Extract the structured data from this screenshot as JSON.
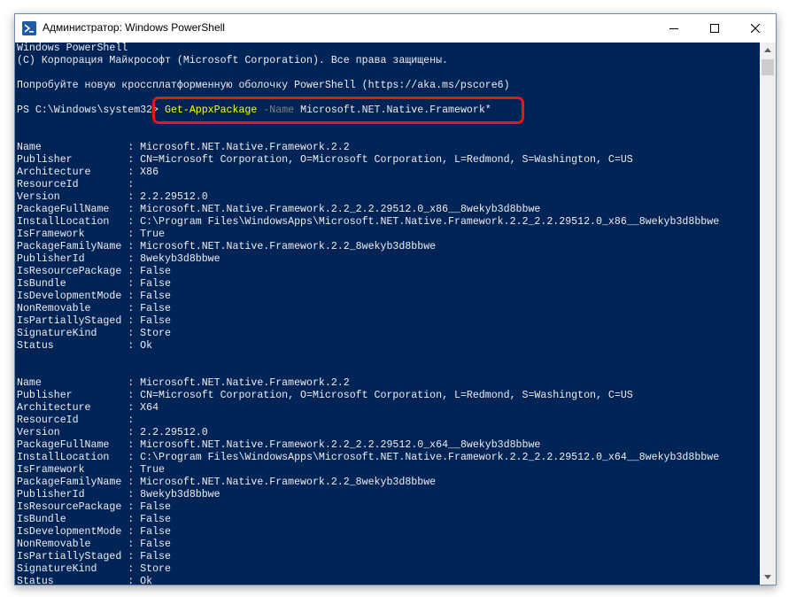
{
  "window": {
    "title": "Администратор: Windows PowerShell",
    "icon": "powershell-icon",
    "controls": [
      "minimize-icon",
      "maximize-icon",
      "close-icon"
    ]
  },
  "console": {
    "background": "#012456",
    "foreground": "#eeedf0",
    "header": [
      "Windows PowerShell",
      "(C) Корпорация Майкрософт (Microsoft Corporation). Все права защищены.",
      "",
      "Попробуйте новую кроссплатформенную оболочку PowerShell (https://aka.ms/pscore6)",
      ""
    ],
    "prompt": {
      "path": "PS C:\\Windows\\system32> ",
      "cmdlet": "Get-AppxPackage",
      "param": " -Name",
      "value": " Microsoft.NET.Native.Framework*"
    },
    "highlight_color": "#e8141e",
    "packages": [
      {
        "Name": "Microsoft.NET.Native.Framework.2.2",
        "Publisher": "CN=Microsoft Corporation, O=Microsoft Corporation, L=Redmond, S=Washington, C=US",
        "Architecture": "X86",
        "ResourceId": "",
        "Version": "2.2.29512.0",
        "PackageFullName": "Microsoft.NET.Native.Framework.2.2_2.2.29512.0_x86__8wekyb3d8bbwe",
        "InstallLocation": "C:\\Program Files\\WindowsApps\\Microsoft.NET.Native.Framework.2.2_2.2.29512.0_x86__8wekyb3d8bbwe",
        "IsFramework": "True",
        "PackageFamilyName": "Microsoft.NET.Native.Framework.2.2_8wekyb3d8bbwe",
        "PublisherId": "8wekyb3d8bbwe",
        "IsResourcePackage": "False",
        "IsBundle": "False",
        "IsDevelopmentMode": "False",
        "NonRemovable": "False",
        "IsPartiallyStaged": "False",
        "SignatureKind": "Store",
        "Status": "Ok"
      },
      {
        "Name": "Microsoft.NET.Native.Framework.2.2",
        "Publisher": "CN=Microsoft Corporation, O=Microsoft Corporation, L=Redmond, S=Washington, C=US",
        "Architecture": "X64",
        "ResourceId": "",
        "Version": "2.2.29512.0",
        "PackageFullName": "Microsoft.NET.Native.Framework.2.2_2.2.29512.0_x64__8wekyb3d8bbwe",
        "InstallLocation": "C:\\Program Files\\WindowsApps\\Microsoft.NET.Native.Framework.2.2_2.2.29512.0_x64__8wekyb3d8bbwe",
        "IsFramework": "True",
        "PackageFamilyName": "Microsoft.NET.Native.Framework.2.2_8wekyb3d8bbwe",
        "PublisherId": "8wekyb3d8bbwe",
        "IsResourcePackage": "False",
        "IsBundle": "False",
        "IsDevelopmentMode": "False",
        "NonRemovable": "False",
        "IsPartiallyStaged": "False",
        "SignatureKind": "Store",
        "Status": "Ok"
      }
    ]
  }
}
